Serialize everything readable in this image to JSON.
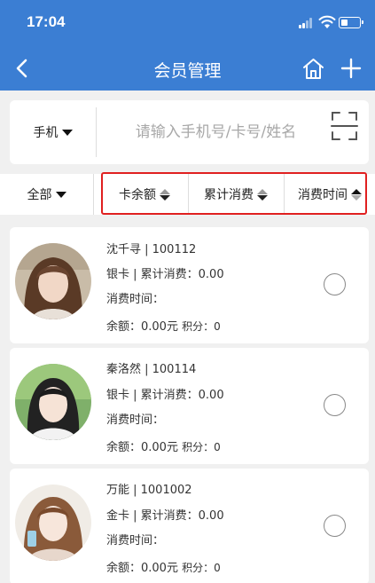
{
  "status_bar": {
    "time": "17:04"
  },
  "nav": {
    "title": "会员管理"
  },
  "search": {
    "type_label": "手机",
    "placeholder": "请输入手机号/卡号/姓名"
  },
  "filter": {
    "all_label": "全部",
    "sort_balance": "卡余额",
    "sort_total": "累计消费",
    "sort_time": "消费时间"
  },
  "members": [
    {
      "name_id": "沈千寻 | 100112",
      "card_total": "银卡 | 累计消费：0.00",
      "time": "消费时间：",
      "balance": "余额：0.00元",
      "points": "积分：0"
    },
    {
      "name_id": "秦洛然 | 100114",
      "card_total": "银卡 | 累计消费：0.00",
      "time": "消费时间：",
      "balance": "余额：0.00元",
      "points": "积分：0"
    },
    {
      "name_id": "万能 | 1001002",
      "card_total": "金卡 | 累计消费：0.00",
      "time": "消费时间：",
      "balance": "余额：0.00元",
      "points": "积分：0"
    }
  ],
  "colors": {
    "primary": "#3b7ed3",
    "highlight": "#e02020",
    "background": "#f0f0f0"
  },
  "icons": [
    "back-arrow-icon",
    "home-icon",
    "plus-icon",
    "scan-icon",
    "signal-icon",
    "wifi-icon",
    "battery-icon"
  ]
}
